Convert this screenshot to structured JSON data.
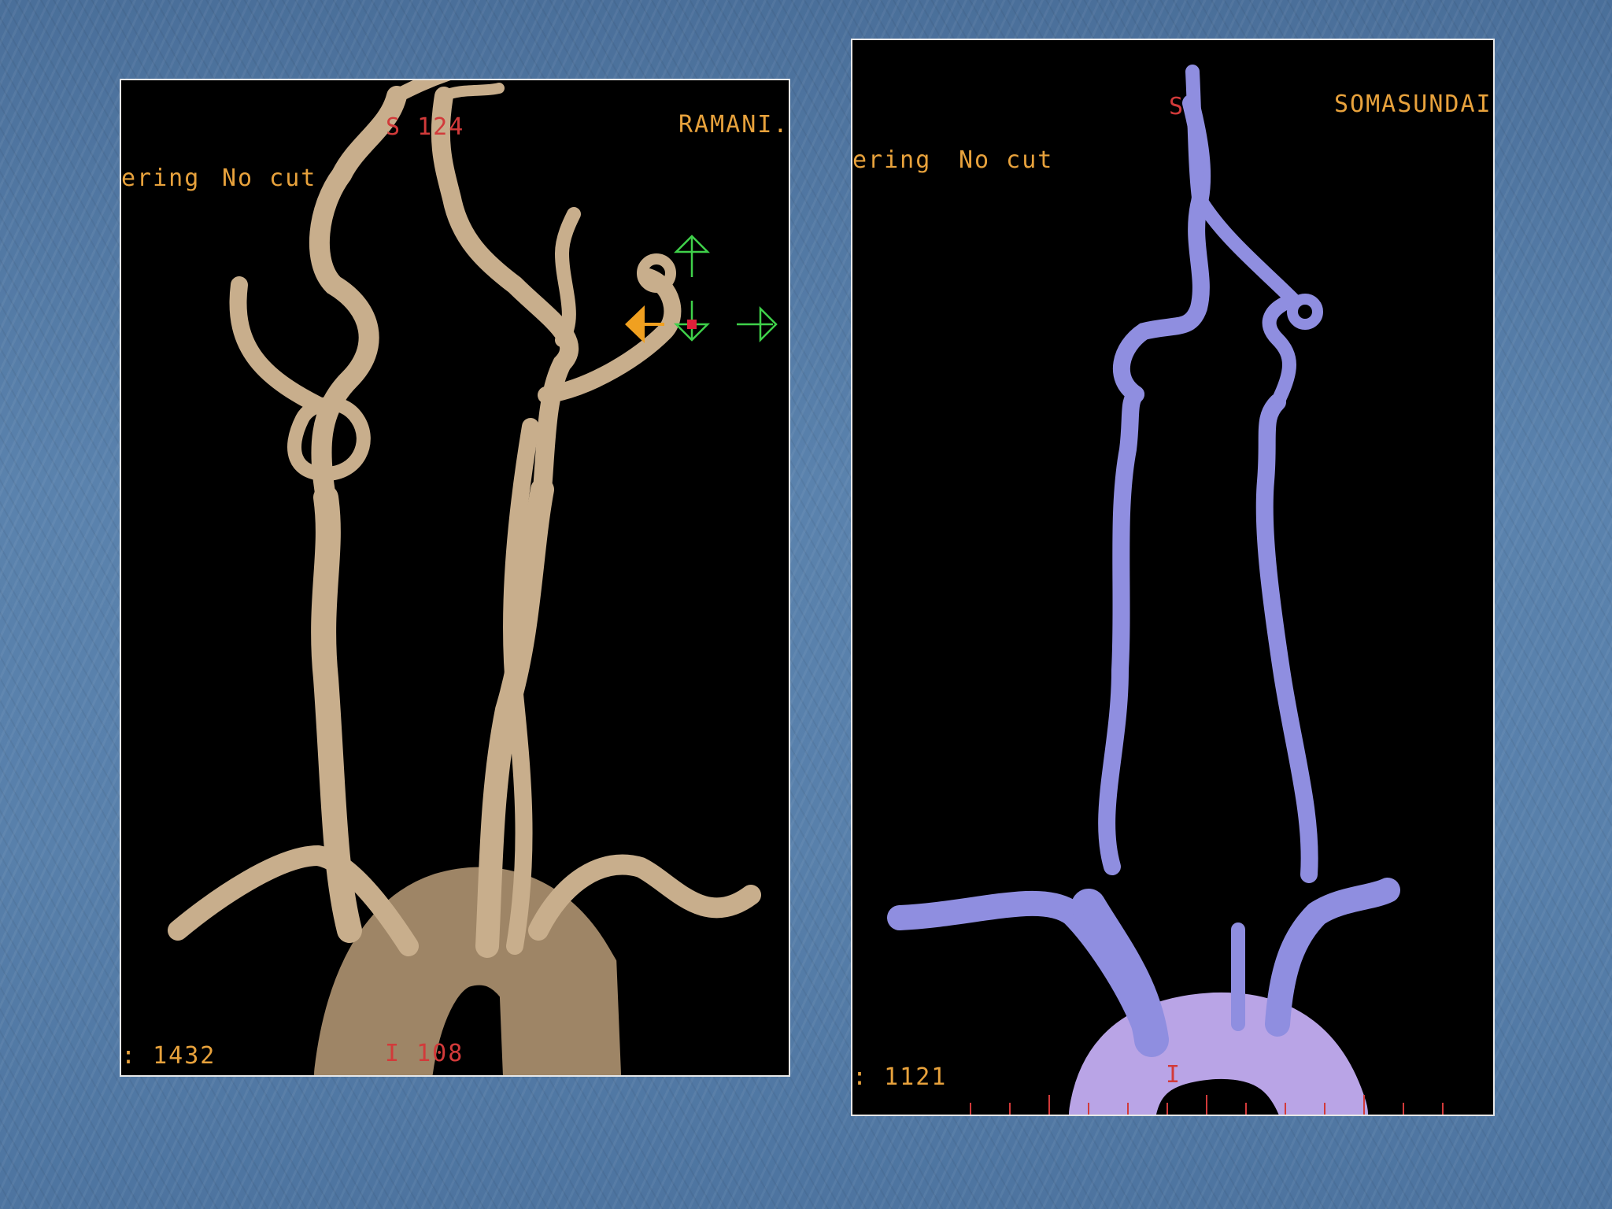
{
  "left_panel": {
    "orientation_top": "S 124",
    "patient_name": "RAMANI.",
    "render_mode": "ering",
    "cut_mode": "No cut",
    "window_value": ": 1432",
    "orientation_bottom": "I 108",
    "vessel_color": "#c8ae8c"
  },
  "right_panel": {
    "orientation_top": "S",
    "patient_name": "SOMASUNDAI",
    "render_mode": "ering",
    "cut_mode": "No cut",
    "window_value": ": 1121",
    "orientation_bottom": "I",
    "vessel_color": "#8f8ee0"
  },
  "colors": {
    "background": "#5a82ad",
    "overlay_text": "#e8a23c",
    "orientation_text": "#d23a3a",
    "nav_arrow_green": "#3fd14a",
    "nav_arrow_orange": "#f0a020"
  }
}
